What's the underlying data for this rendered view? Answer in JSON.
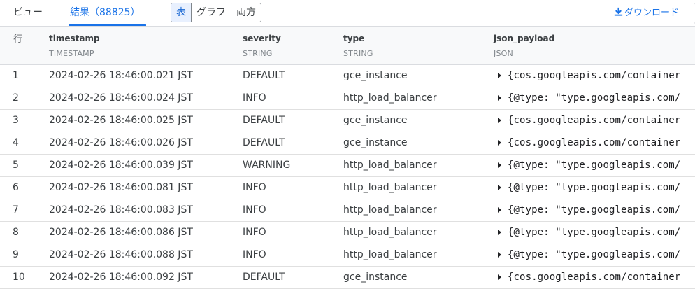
{
  "tabs": {
    "view": "ビュー",
    "results": "結果（88825）"
  },
  "segmented": [
    "表",
    "グラフ",
    "両方"
  ],
  "download_label": "ダウンロード",
  "table": {
    "row_number_header": "行",
    "columns": [
      {
        "name": "timestamp",
        "type": "TIMESTAMP"
      },
      {
        "name": "severity",
        "type": "STRING"
      },
      {
        "name": "type",
        "type": "STRING"
      },
      {
        "name": "json_payload",
        "type": "JSON"
      }
    ],
    "rows": [
      {
        "no": "1",
        "timestamp": "2024-02-26 18:46:00.021 JST",
        "severity": "DEFAULT",
        "type": "gce_instance",
        "json": "{cos.googleapis.com/container"
      },
      {
        "no": "2",
        "timestamp": "2024-02-26 18:46:00.024 JST",
        "severity": "INFO",
        "type": "http_load_balancer",
        "json": "{@type: \"type.googleapis.com/"
      },
      {
        "no": "3",
        "timestamp": "2024-02-26 18:46:00.025 JST",
        "severity": "DEFAULT",
        "type": "gce_instance",
        "json": "{cos.googleapis.com/container"
      },
      {
        "no": "4",
        "timestamp": "2024-02-26 18:46:00.026 JST",
        "severity": "DEFAULT",
        "type": "gce_instance",
        "json": "{cos.googleapis.com/container"
      },
      {
        "no": "5",
        "timestamp": "2024-02-26 18:46:00.039 JST",
        "severity": "WARNING",
        "type": "http_load_balancer",
        "json": "{@type: \"type.googleapis.com/"
      },
      {
        "no": "6",
        "timestamp": "2024-02-26 18:46:00.081 JST",
        "severity": "INFO",
        "type": "http_load_balancer",
        "json": "{@type: \"type.googleapis.com/"
      },
      {
        "no": "7",
        "timestamp": "2024-02-26 18:46:00.083 JST",
        "severity": "INFO",
        "type": "http_load_balancer",
        "json": "{@type: \"type.googleapis.com/"
      },
      {
        "no": "8",
        "timestamp": "2024-02-26 18:46:00.086 JST",
        "severity": "INFO",
        "type": "http_load_balancer",
        "json": "{@type: \"type.googleapis.com/"
      },
      {
        "no": "9",
        "timestamp": "2024-02-26 18:46:00.088 JST",
        "severity": "INFO",
        "type": "http_load_balancer",
        "json": "{@type: \"type.googleapis.com/"
      },
      {
        "no": "10",
        "timestamp": "2024-02-26 18:46:00.092 JST",
        "severity": "DEFAULT",
        "type": "gce_instance",
        "json": "{cos.googleapis.com/container"
      }
    ]
  },
  "icons": {
    "download": "download-icon",
    "expand": "expand-triangle-icon"
  },
  "colors": {
    "accent": "#1a73e8",
    "segment_active_bg": "#e8f0fe"
  }
}
